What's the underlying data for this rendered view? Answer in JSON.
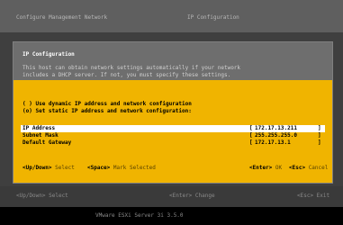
{
  "top_bar": {
    "left_title": "Configure Management Network",
    "right_title": "IP Configuration"
  },
  "dialog": {
    "title": "IP Configuration",
    "description_line1": "This host can obtain network settings automatically if your network",
    "description_line2": "includes a DHCP server. If not, you must specify these settings.",
    "options": [
      {
        "marker": "( )",
        "label": "Use dynamic IP address and network configuration"
      },
      {
        "marker": "(o)",
        "label": "Set static IP address and network configuration:"
      }
    ],
    "fields": [
      {
        "label": "IP Address",
        "value": "172.17.13.211"
      },
      {
        "label": "Subnet Mask",
        "value": "255.255.255.0"
      },
      {
        "label": "Default Gateway",
        "value": "172.17.13.1"
      }
    ],
    "hints": {
      "select_key": "<Up/Down>",
      "select_label": "Select",
      "mark_key": "<Space>",
      "mark_label": "Mark Selected",
      "ok_key": "<Enter>",
      "ok_label": "OK",
      "cancel_key": "<Esc>",
      "cancel_label": "Cancel"
    }
  },
  "bottom_bar": {
    "select": "<Up/Down> Select",
    "change": "<Enter> Change",
    "exit": "<Esc> Exit"
  },
  "footer": {
    "product": "VMware ESXi Server 3i 3.5.0"
  }
}
